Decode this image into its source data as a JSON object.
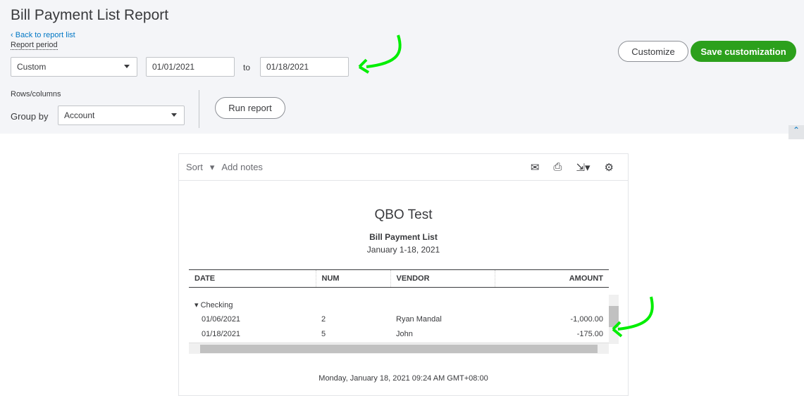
{
  "page": {
    "title": "Bill Payment List Report",
    "back": "Back to report list",
    "report_period": "Report period",
    "period": "Custom",
    "from": "01/01/2021",
    "to_label": "to",
    "to": "01/18/2021",
    "rows_columns": "Rows/columns",
    "group_by_label": "Group by",
    "group_by": "Account",
    "run": "Run report",
    "customize": "Customize",
    "save": "Save customization"
  },
  "report": {
    "sort": "Sort",
    "add_notes": "Add notes",
    "company": "QBO Test",
    "name": "Bill Payment List",
    "range": "January 1-18, 2021",
    "columns": [
      "DATE",
      "NUM",
      "VENDOR",
      "AMOUNT"
    ],
    "group": "Checking",
    "rows": [
      [
        "01/06/2021",
        "2",
        "Ryan Mandal",
        "-1,000.00"
      ],
      [
        "01/18/2021",
        "5",
        "John",
        "-175.00"
      ]
    ],
    "footer": "Monday, January 18, 2021   09:24 AM GMT+08:00"
  }
}
